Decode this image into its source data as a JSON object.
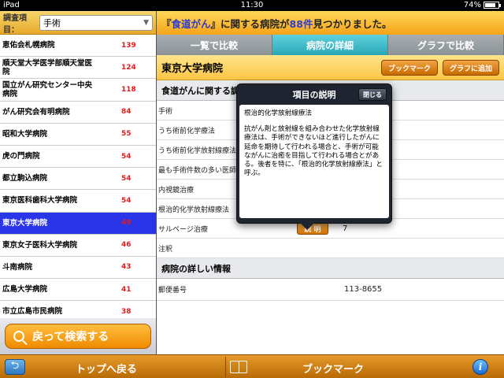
{
  "status": {
    "carrier": "iPad",
    "time": "11:30",
    "battery": "74%"
  },
  "search": {
    "label": "調査項目：",
    "selected": "手術"
  },
  "hospital_list": [
    {
      "name": "恵佑会札幌病院",
      "count": "139"
    },
    {
      "name": "順天堂大学医学部順天堂医院",
      "count": "124"
    },
    {
      "name": "国立がん研究センター中央病院",
      "count": "118"
    },
    {
      "name": "がん研究会有明病院",
      "count": "84"
    },
    {
      "name": "昭和大学病院",
      "count": "55"
    },
    {
      "name": "虎の門病院",
      "count": "54"
    },
    {
      "name": "都立駒込病院",
      "count": "54"
    },
    {
      "name": "東京医科歯科大学病院",
      "count": "54"
    },
    {
      "name": "東京大学病院",
      "count": "49"
    },
    {
      "name": "東京女子医科大学病院",
      "count": "46"
    },
    {
      "name": "斗南病院",
      "count": "43"
    },
    {
      "name": "広島大学病院",
      "count": "41"
    },
    {
      "name": "市立広島市民病院",
      "count": "38"
    }
  ],
  "back_search_label": "戻って検索する",
  "banner": {
    "prefix": "『",
    "keyword": "食道がん",
    "mid": "』に関する病院が ",
    "count": "88件",
    "suffix": " 見つかりました。"
  },
  "tabs": [
    "一覧で比較",
    "病院の詳細",
    "グラフで比較"
  ],
  "hospital": {
    "name": "東京大学病院",
    "bookmark_label": "ブックマーク",
    "add_graph_label": "グラフに追加"
  },
  "section1_title": "食道がんに関する調査結果",
  "detail_rows": [
    {
      "key": "手術",
      "value": ""
    },
    {
      "key": "うち術前化学療法",
      "value": ""
    },
    {
      "key": "うち術前化学放射線療法",
      "value": ""
    },
    {
      "key": "最も手術件数の多い医師",
      "value": ""
    },
    {
      "key": "内視鏡治療",
      "value": ""
    },
    {
      "key": "根治的化学放射線療法",
      "value": "33"
    },
    {
      "key": "サルベージ治療",
      "value": "7"
    },
    {
      "key": "注釈",
      "value": ""
    }
  ],
  "explain_label": "説 明",
  "section2_title": "病院の詳しい情報",
  "postal": {
    "key": "郵便番号",
    "value": "113-8655"
  },
  "popover": {
    "title": "項目の説明",
    "close_label": "閉じる",
    "term": "根治的化学放射線療法",
    "desc": "抗がん剤と放射線を組み合わせた化学放射線療法は、手術ができないほど進行したがんに延命を期待して行われる場合と、手術が可能ながんに治癒を目指して行われる場合とがある。後者を特に、「根治的化学放射線療法」と呼ぶ。"
  },
  "bottom": {
    "top_label": "トップへ戻る",
    "bookmark_label": "ブックマーク",
    "info_label": "i"
  }
}
